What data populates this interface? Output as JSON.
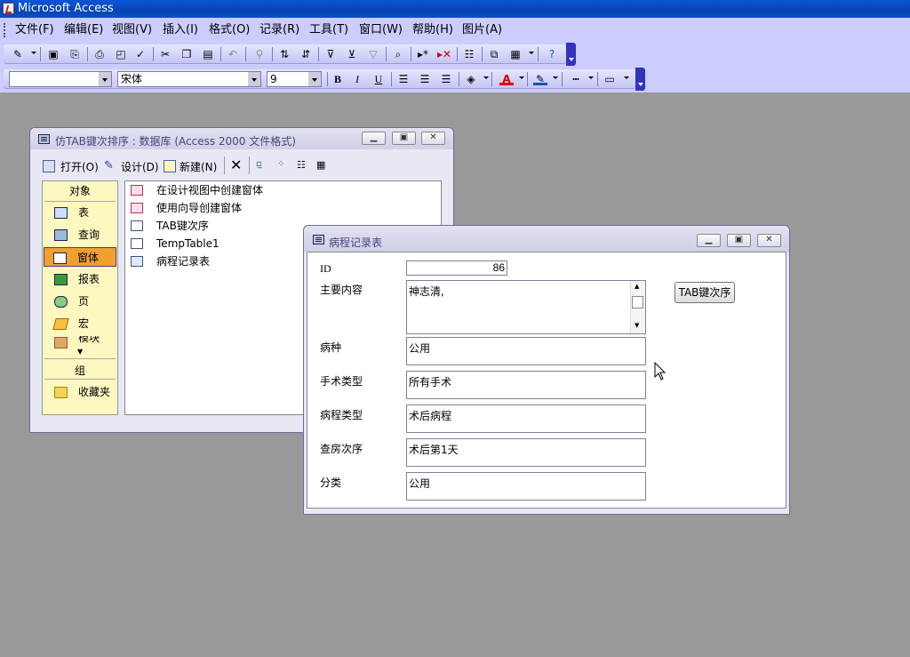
{
  "app": {
    "title": "Microsoft Access"
  },
  "menu": {
    "file": "文件(F)",
    "edit": "编辑(E)",
    "view": "视图(V)",
    "insert": "插入(I)",
    "format": "格式(O)",
    "records": "记录(R)",
    "tools": "工具(T)",
    "window": "窗口(W)",
    "help": "帮助(H)",
    "picture": "图片(A)"
  },
  "format_toolbar": {
    "object_combo": "",
    "font": "宋体",
    "font_size": "9"
  },
  "db_window": {
    "title": "仿TAB键次排序 : 数据库 (Access 2000 文件格式)",
    "toolbar": {
      "open": "打开(O)",
      "design": "设计(D)",
      "new": "新建(N)"
    },
    "objects_header": "对象",
    "objects": [
      "表",
      "查询",
      "窗体",
      "报表",
      "页",
      "宏",
      "模块"
    ],
    "groups_header": "组",
    "favorites": "收藏夹",
    "list": [
      "在设计视图中创建窗体",
      "使用向导创建窗体",
      "TAB键次序",
      "TempTable1",
      "病程记录表"
    ]
  },
  "form_window": {
    "title": "病程记录表",
    "id_label": "ID",
    "id_value": "86",
    "content_label": "主要内容",
    "content_value": "神志清,",
    "disease_label": "病种",
    "disease_value": "公用",
    "surgery_label": "手术类型",
    "surgery_value": "所有手术",
    "course_label": "病程类型",
    "course_value": "术后病程",
    "rounds_label": "查房次序",
    "rounds_value": "术后第1天",
    "category_label": "分类",
    "category_value": "公用",
    "tab_button": "TAB键次序"
  },
  "colors": {
    "title_bar": "#0a56d8",
    "toolbar": "#ccccff",
    "workspace": "#999999",
    "selected_object": "#f0a030"
  }
}
